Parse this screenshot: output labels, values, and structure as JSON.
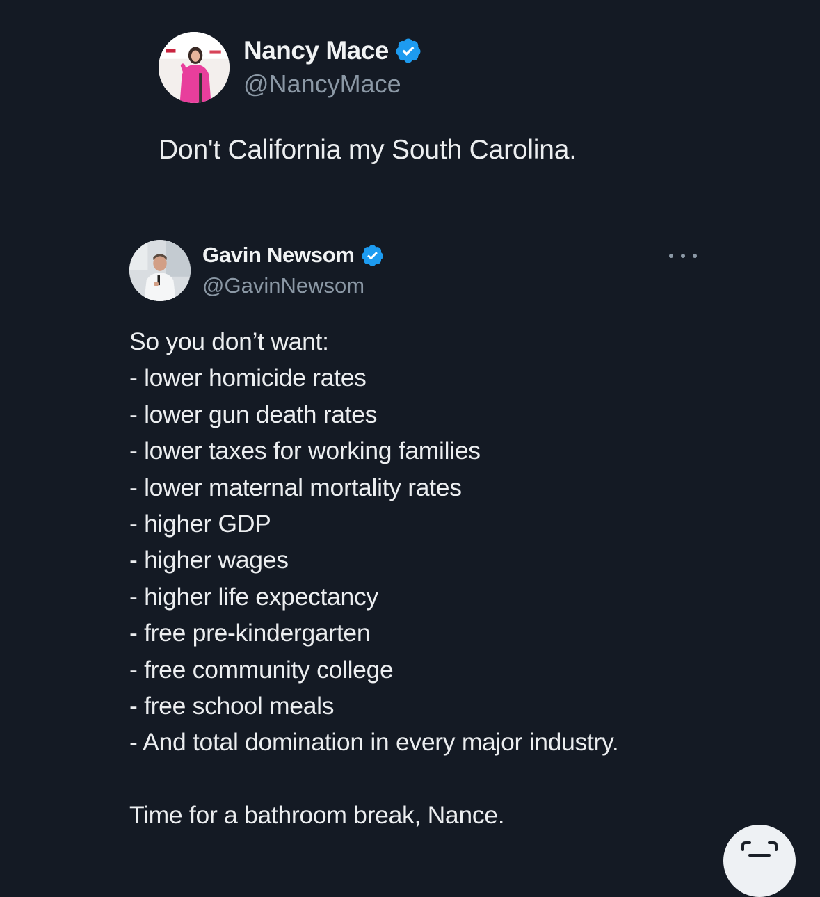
{
  "quoted_tweet": {
    "author_name": "Nancy Mace",
    "handle": "@NancyMace",
    "verified_icon": "verified-badge-icon",
    "text": "Don't California my South Carolina."
  },
  "reply_tweet": {
    "author_name": "Gavin Newsom",
    "handle": "@GavinNewsom",
    "verified_icon": "verified-badge-icon",
    "more_icon": "more-options-icon",
    "lines": [
      "So you don’t want:",
      "- lower homicide rates",
      "- lower gun death rates",
      "- lower taxes for working families",
      "- lower maternal mortality rates",
      "- higher GDP",
      "- higher wages",
      "- higher life expectancy",
      "- free pre-kindergarten",
      "- free community college",
      "- free school meals",
      "- And total domination in every major industry."
    ],
    "closing": "Time for a bathroom break, Nance."
  },
  "corner_button": {
    "icon": "scan-icon"
  },
  "colors": {
    "background": "#141a24",
    "text_primary": "#e7e9ea",
    "text_secondary": "#8b98a5",
    "verified_blue": "#1d9bf0"
  }
}
